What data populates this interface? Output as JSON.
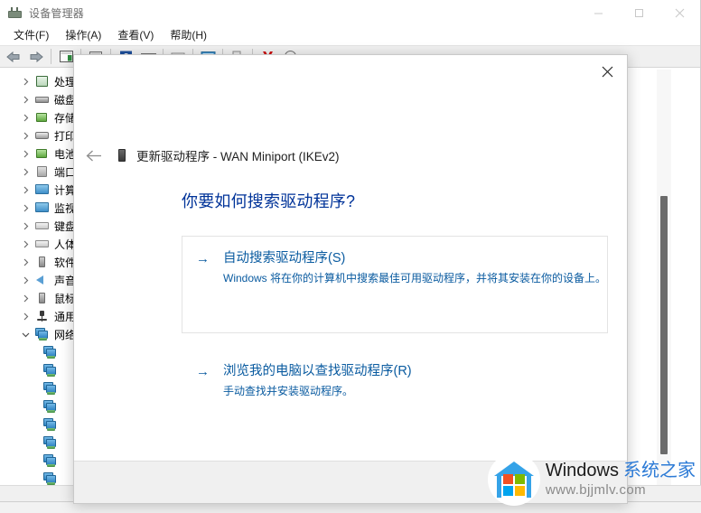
{
  "window": {
    "title": "设备管理器",
    "title_icon": "device-manager-icon",
    "controls": {
      "minimize": "—",
      "maximize": "□",
      "close": "✕"
    },
    "menubar": [
      {
        "label": "文件(F)"
      },
      {
        "label": "操作(A)"
      },
      {
        "label": "查看(V)"
      },
      {
        "label": "帮助(H)"
      }
    ],
    "toolbar": [
      {
        "name": "back-button",
        "icon": "arrow-left-icon"
      },
      {
        "name": "forward-button",
        "icon": "arrow-right-icon"
      },
      {
        "name": "show-hidden-devices-button",
        "icon": "list-view-icon"
      },
      {
        "name": "properties-button",
        "icon": "properties-icon"
      },
      {
        "name": "help-button",
        "icon": "help-icon"
      },
      {
        "name": "update-driver-button",
        "icon": "update-driver-icon"
      },
      {
        "name": "scan-hardware-button",
        "icon": "scan-hardware-icon"
      },
      {
        "name": "display-view-button",
        "icon": "display-icon"
      },
      {
        "name": "enable-device-button",
        "icon": "enable-device-icon"
      },
      {
        "name": "uninstall-device-button",
        "icon": "uninstall-device-icon"
      },
      {
        "name": "disable-device-button",
        "icon": "disable-device-icon"
      }
    ]
  },
  "tree": {
    "items": [
      {
        "label": "处理",
        "icon": "processor-icon",
        "expanded": false,
        "level": 0
      },
      {
        "label": "磁盘",
        "icon": "disk-drive-icon",
        "expanded": false,
        "level": 0
      },
      {
        "label": "存储",
        "icon": "storage-controller-icon",
        "expanded": false,
        "level": 0
      },
      {
        "label": "打印",
        "icon": "print-queue-icon",
        "expanded": false,
        "level": 0
      },
      {
        "label": "电池",
        "icon": "battery-icon",
        "expanded": false,
        "level": 0
      },
      {
        "label": "端口",
        "icon": "ports-icon",
        "expanded": false,
        "level": 0
      },
      {
        "label": "计算",
        "icon": "computer-icon",
        "expanded": false,
        "level": 0
      },
      {
        "label": "监视",
        "icon": "monitor-icon",
        "expanded": false,
        "level": 0
      },
      {
        "label": "键盘",
        "icon": "keyboard-icon",
        "expanded": false,
        "level": 0
      },
      {
        "label": "人体",
        "icon": "hid-icon",
        "expanded": false,
        "level": 0
      },
      {
        "label": "软件",
        "icon": "software-device-icon",
        "expanded": false,
        "level": 0
      },
      {
        "label": "声音",
        "icon": "sound-icon",
        "expanded": false,
        "level": 0
      },
      {
        "label": "鼠标",
        "icon": "mouse-icon",
        "expanded": false,
        "level": 0
      },
      {
        "label": "通用",
        "icon": "usb-controller-icon",
        "expanded": false,
        "level": 0
      },
      {
        "label": "网络",
        "icon": "network-adapter-icon",
        "expanded": true,
        "level": 0
      },
      {
        "label": "",
        "icon": "network-adapter-icon",
        "level": 1
      },
      {
        "label": "",
        "icon": "network-adapter-icon",
        "level": 1
      },
      {
        "label": "",
        "icon": "network-adapter-icon",
        "level": 1
      },
      {
        "label": "",
        "icon": "network-adapter-icon",
        "level": 1
      },
      {
        "label": "",
        "icon": "network-adapter-icon",
        "level": 1
      },
      {
        "label": "",
        "icon": "network-adapter-icon",
        "level": 1
      },
      {
        "label": "",
        "icon": "network-adapter-icon",
        "level": 1
      },
      {
        "label": "",
        "icon": "network-adapter-icon",
        "level": 1
      }
    ]
  },
  "dialog": {
    "close_label": "✕",
    "back_label": "←",
    "device_icon": "device-icon",
    "title": "更新驱动程序 - WAN Miniport (IKEv2)",
    "heading": "你要如何搜索驱动程序?",
    "options": [
      {
        "arrow": "→",
        "title": "自动搜索驱动程序(S)",
        "desc": "Windows 将在你的计算机中搜索最佳可用驱动程序，并将其安装在你的设备上。",
        "hovered": true
      },
      {
        "arrow": "→",
        "title": "浏览我的电脑以查找驱动程序(R)",
        "desc": "手动查找并安装驱动程序。",
        "hovered": false
      }
    ]
  },
  "watermark": {
    "brand_en": "Windows",
    "brand_cn": "系统之家",
    "url": "www.bjjmlv.com"
  },
  "colors": {
    "heading": "#003399",
    "link": "#0a5ba0",
    "ms_red": "#f25022",
    "ms_green": "#7fba00",
    "ms_blue": "#00a4ef",
    "ms_yellow": "#ffb900",
    "logo_blue": "#35a3e8"
  }
}
